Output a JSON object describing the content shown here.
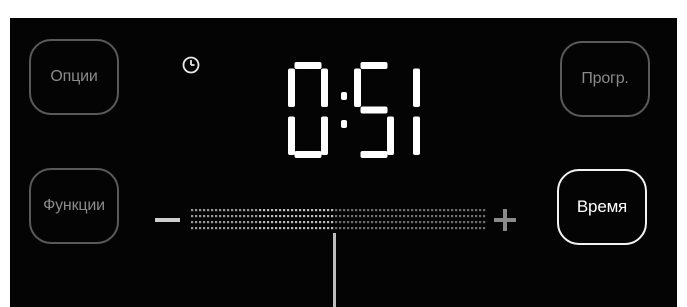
{
  "buttons": {
    "options": "Опции",
    "functions": "Функции",
    "preheat": "Прогр.",
    "time": "Время"
  },
  "display": {
    "time": "0:51"
  },
  "icons": {
    "clock": "clock-icon",
    "minus": "minus-icon",
    "plus": "plus-icon"
  },
  "slider": {
    "level": 0.48
  },
  "colors": {
    "panel_background": "#040404",
    "segment_on": "#ffffff",
    "button_dim_text": "#8a8a8a",
    "button_active_text": "#ffffff"
  }
}
